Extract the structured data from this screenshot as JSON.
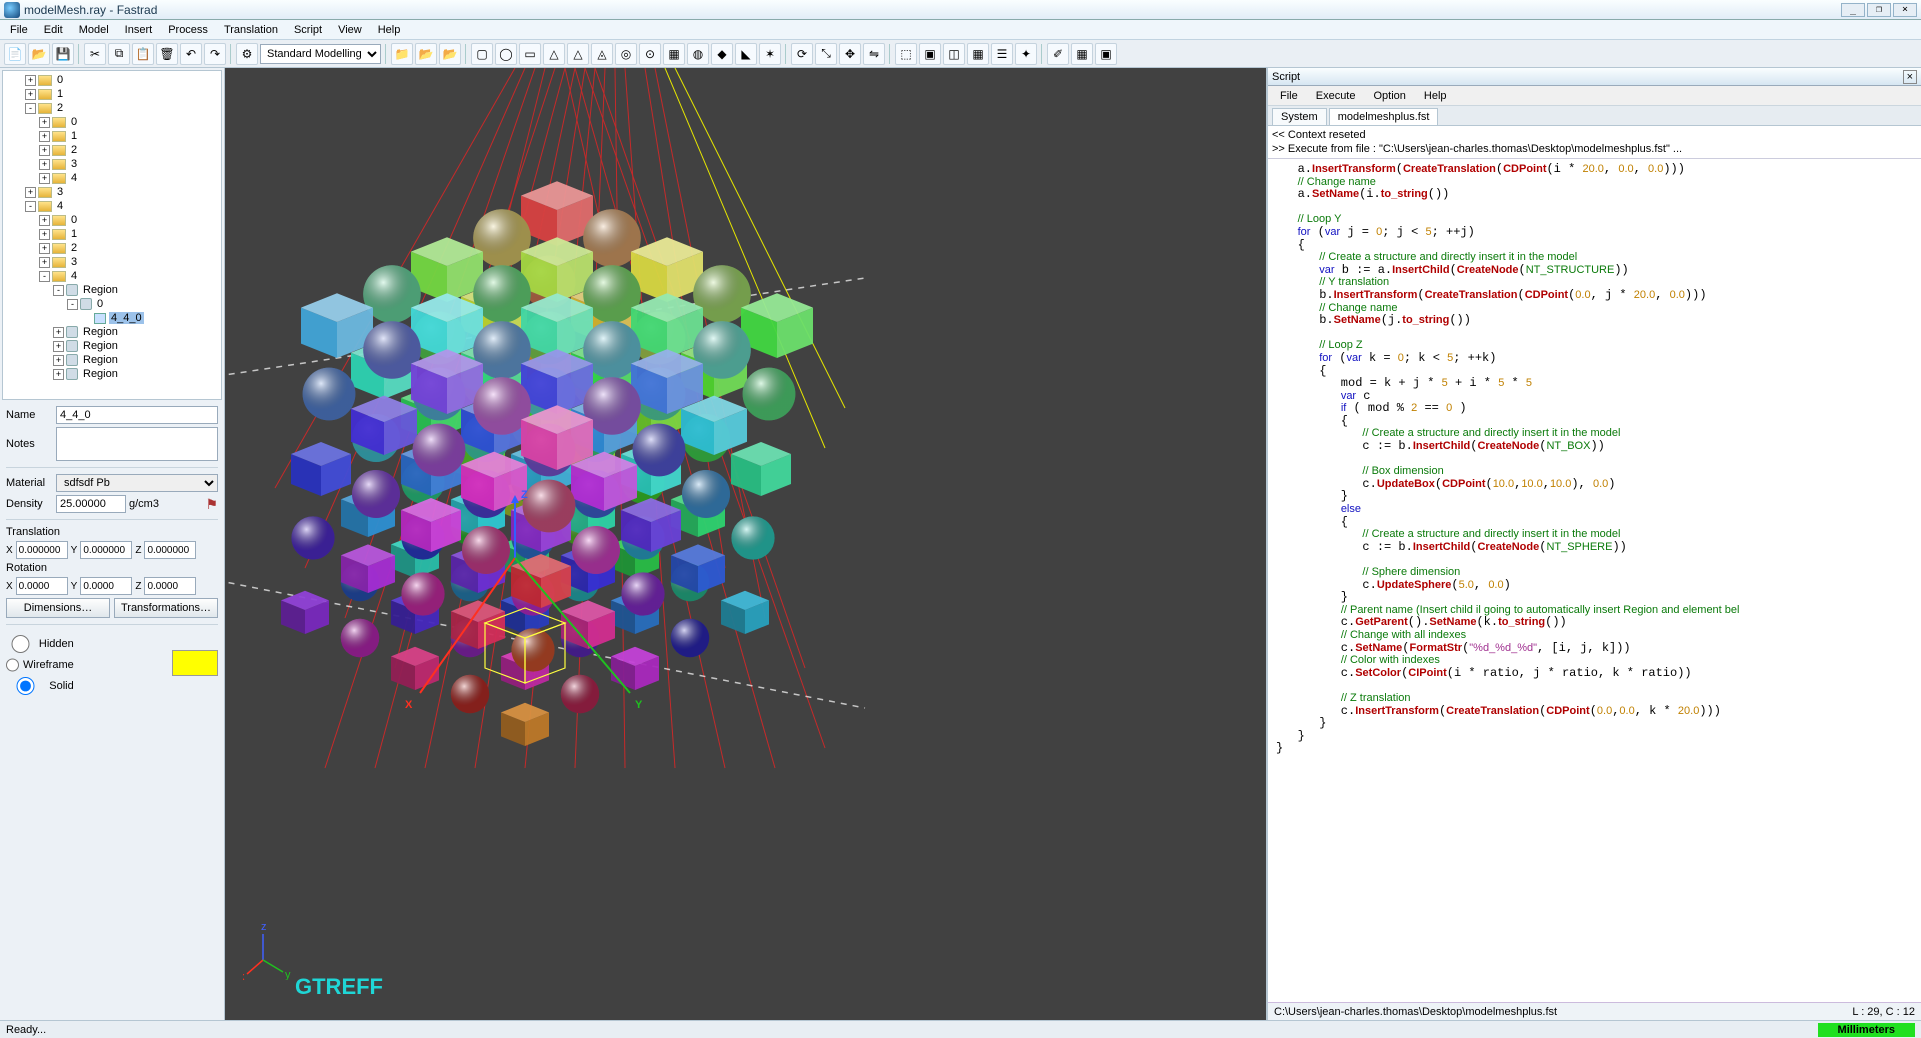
{
  "window": {
    "title": "modelMesh.ray - Fastrad"
  },
  "menu": {
    "items": [
      "File",
      "Edit",
      "Model",
      "Insert",
      "Process",
      "Translation",
      "Script",
      "View",
      "Help"
    ]
  },
  "toolbar": {
    "modeling_mode": "Standard Modelling"
  },
  "tree": {
    "items": [
      {
        "d": 1,
        "e": "+",
        "t": "f",
        "l": "0"
      },
      {
        "d": 1,
        "e": "+",
        "t": "f",
        "l": "1"
      },
      {
        "d": 1,
        "e": "-",
        "t": "f",
        "l": "2"
      },
      {
        "d": 2,
        "e": "+",
        "t": "f",
        "l": "0"
      },
      {
        "d": 2,
        "e": "+",
        "t": "f",
        "l": "1"
      },
      {
        "d": 2,
        "e": "+",
        "t": "f",
        "l": "2"
      },
      {
        "d": 2,
        "e": "+",
        "t": "f",
        "l": "3"
      },
      {
        "d": 2,
        "e": "+",
        "t": "f",
        "l": "4"
      },
      {
        "d": 1,
        "e": "+",
        "t": "f",
        "l": "3"
      },
      {
        "d": 1,
        "e": "-",
        "t": "f",
        "l": "4"
      },
      {
        "d": 2,
        "e": "+",
        "t": "f",
        "l": "0"
      },
      {
        "d": 2,
        "e": "+",
        "t": "f",
        "l": "1"
      },
      {
        "d": 2,
        "e": "+",
        "t": "f",
        "l": "2"
      },
      {
        "d": 2,
        "e": "+",
        "t": "f",
        "l": "3"
      },
      {
        "d": 2,
        "e": "-",
        "t": "f",
        "l": "4"
      },
      {
        "d": 3,
        "e": "-",
        "t": "r",
        "l": "Region"
      },
      {
        "d": 4,
        "e": "-",
        "t": "r",
        "l": "0"
      },
      {
        "d": 5,
        "e": "",
        "t": "s",
        "l": "4_4_0",
        "sel": true
      },
      {
        "d": 3,
        "e": "+",
        "t": "r",
        "l": "Region"
      },
      {
        "d": 3,
        "e": "+",
        "t": "r",
        "l": "Region"
      },
      {
        "d": 3,
        "e": "+",
        "t": "r",
        "l": "Region"
      },
      {
        "d": 3,
        "e": "+",
        "t": "r",
        "l": "Region"
      }
    ]
  },
  "props": {
    "name_label": "Name",
    "name": "4_4_0",
    "notes_label": "Notes",
    "notes": "",
    "material_label": "Material",
    "material": "sdfsdf Pb",
    "density_label": "Density",
    "density": "25.00000",
    "density_unit": "g/cm3",
    "translation_label": "Translation",
    "rotation_label": "Rotation",
    "tx": "0.000000",
    "ty": "0.000000",
    "tz": "0.000000",
    "rx": "0.0000",
    "ry": "0.0000",
    "rz": "0.0000",
    "dimensions_btn": "Dimensions…",
    "transformations_btn": "Transformations…",
    "hidden": "Hidden",
    "wireframe": "Wireframe",
    "solid": "Solid",
    "color": "#ffff00"
  },
  "viewport": {
    "label": "GTREFF",
    "axes": {
      "x": "X",
      "y": "Y",
      "z": "Z"
    },
    "small_axes": {
      "x": "x",
      "y": "y",
      "z": "z"
    }
  },
  "script": {
    "title": "Script",
    "menu": [
      "File",
      "Execute",
      "Option",
      "Help"
    ],
    "tabs": [
      "System",
      "modelmeshplus.fst"
    ],
    "ctx1": "<< Context reseted",
    "ctx2": ">> Execute from file : \"C:\\Users\\jean-charles.thomas\\Desktop\\modelmeshplus.fst\" ...",
    "status_path": "C:\\Users\\jean-charles.thomas\\Desktop\\modelmeshplus.fst",
    "status_pos": "L : 29, C : 12"
  },
  "status": {
    "ready": "Ready...",
    "units": "Millimeters"
  }
}
